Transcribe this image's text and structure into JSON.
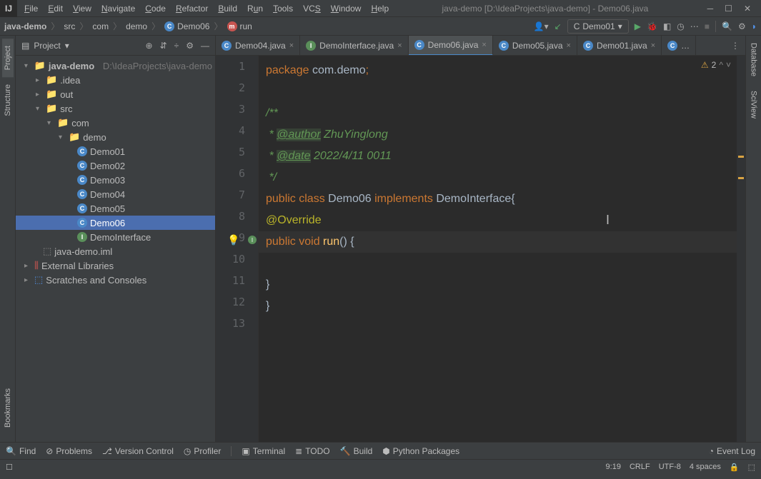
{
  "menu": [
    "File",
    "Edit",
    "View",
    "Navigate",
    "Code",
    "Refactor",
    "Build",
    "Run",
    "Tools",
    "VCS",
    "Window",
    "Help"
  ],
  "title": "java-demo [D:\\IdeaProjects\\java-demo] - Demo06.java",
  "breadcrumb": {
    "proj": "java-demo",
    "src": "src",
    "com": "com",
    "demo": "demo",
    "cls": "Demo06",
    "mth": "run"
  },
  "runConfig": "Demo01",
  "panel": {
    "title": "Project"
  },
  "tree": {
    "root": "java-demo",
    "rootPath": "D:\\IdeaProjects\\java-demo",
    "idea": ".idea",
    "out": "out",
    "src": "src",
    "com": "com",
    "demoPkg": "demo",
    "items": [
      "Demo01",
      "Demo02",
      "Demo03",
      "Demo04",
      "Demo05",
      "Demo06",
      "DemoInterface"
    ],
    "iml": "java-demo.iml",
    "ext": "External Libraries",
    "scratch": "Scratches and Consoles"
  },
  "tabs": [
    "Demo04.java",
    "DemoInterface.java",
    "Demo06.java",
    "Demo05.java",
    "Demo01.java"
  ],
  "activeTab": 2,
  "warnCount": "2",
  "code": {
    "l1a": "package ",
    "l1b": "com.demo",
    "l1c": ";",
    "l3": "/**",
    "l4a": " * ",
    "l4tag": "@author",
    "l4b": " ZhuYinglong",
    "l5a": " * ",
    "l5tag": "@date",
    "l5b": " 2022/4/11 0011",
    "l6": " */",
    "l7a": "public class ",
    "l7b": "Demo06 ",
    "l7c": "implements ",
    "l7d": "DemoInterface{",
    "l8": "@Override",
    "l9a": "public void ",
    "l9b": "run",
    "l9c": "() {",
    "l11": "}",
    "l12": "}"
  },
  "leftTabs": {
    "project": "Project",
    "structure": "Structure",
    "bookmarks": "Bookmarks"
  },
  "rightTabs": {
    "database": "Database",
    "sciview": "SciView"
  },
  "bottomTools": {
    "find": "Find",
    "problems": "Problems",
    "vcs": "Version Control",
    "profiler": "Profiler",
    "terminal": "Terminal",
    "todo": "TODO",
    "build": "Build",
    "python": "Python Packages",
    "eventlog": "Event Log"
  },
  "status": {
    "pos": "9:19",
    "sep": "CRLF",
    "enc": "UTF-8",
    "indent": "4 spaces"
  }
}
